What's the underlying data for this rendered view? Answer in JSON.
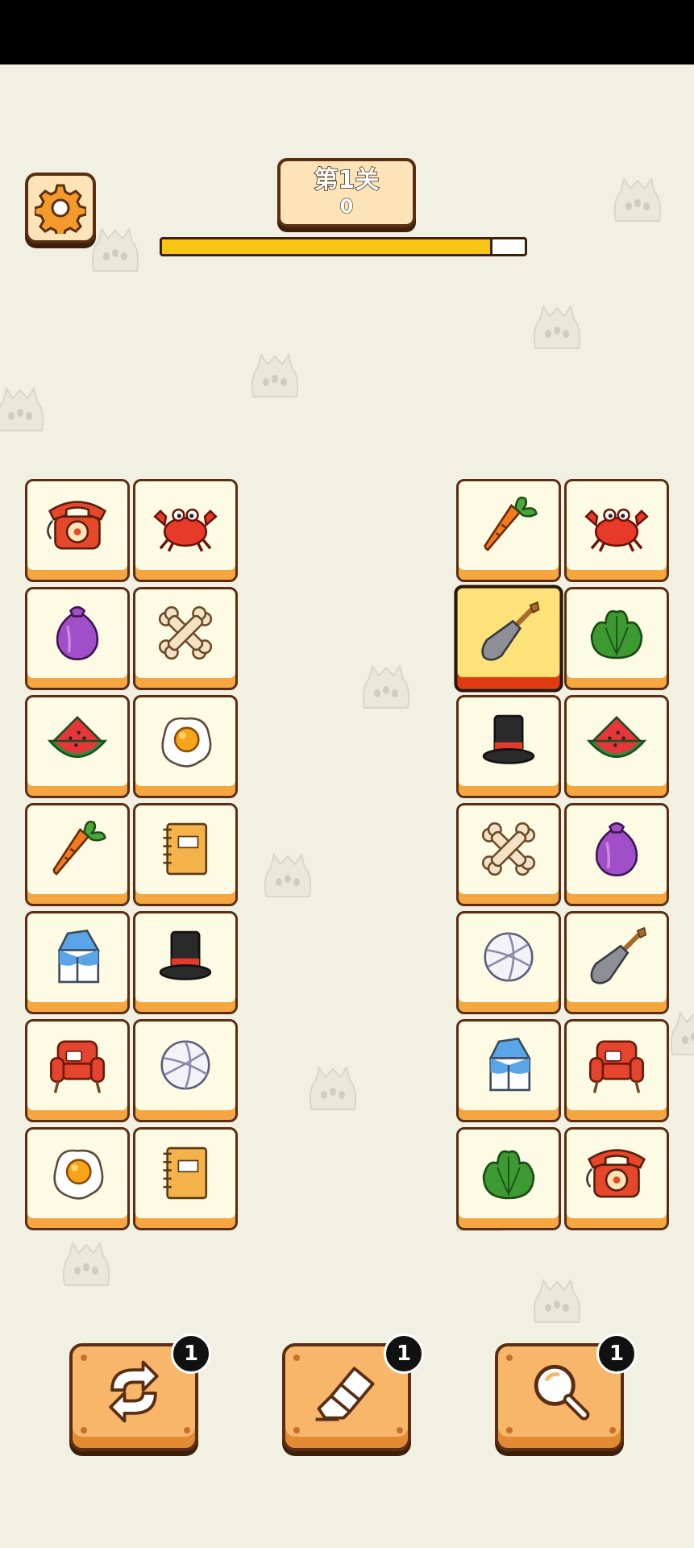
{
  "header": {
    "level_title": "第1关",
    "score": "0",
    "progress_fraction": 0.91
  },
  "board": {
    "left_tiles": [
      "telephone",
      "crab",
      "onion",
      "bone",
      "watermelon",
      "fried-egg",
      "carrot",
      "notebook",
      "milk-carton",
      "top-hat",
      "armchair",
      "volleyball",
      "fried-egg",
      "notebook"
    ],
    "right_tiles": [
      "carrot",
      "crab",
      "shovel",
      "lettuce",
      "top-hat",
      "watermelon",
      "bone",
      "onion",
      "volleyball",
      "shovel",
      "milk-carton",
      "armchair",
      "lettuce",
      "telephone"
    ],
    "selected": {
      "group": "right",
      "index": 2
    }
  },
  "tools": [
    {
      "name": "shuffle",
      "icon": "shuffle-icon",
      "count": "1"
    },
    {
      "name": "eraser",
      "icon": "eraser-icon",
      "count": "1"
    },
    {
      "name": "hint",
      "icon": "magnifier-icon",
      "count": "1"
    }
  ],
  "colors": {
    "background": "#f1f0e3",
    "tile_face": "#fefbe4",
    "tile_edge": "#f6a640",
    "selected_face": "#fde27a",
    "selected_edge": "#e23a10",
    "progress": "#f9c513",
    "button": "#f8b66b"
  }
}
